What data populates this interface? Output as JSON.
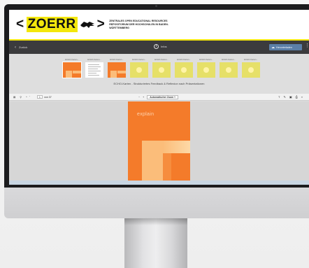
{
  "header": {
    "logo_left_bracket": "<",
    "logo_brand": "ZOERR",
    "logo_right_bracket": ">",
    "tagline": "ZENTRALES OPEN EDUCATIONAL RESOURCES REPOSITORIUM DER HOCHSCHULEN IN BADEN-WÜRTTEMBERG",
    "accent_color": "#f3e70c"
  },
  "toolbar": {
    "back_label": "Zurück",
    "info_label": "Infos",
    "download_label": "Herunterladen",
    "menu_icon": "kebab-icon"
  },
  "thumbnails": {
    "items": [
      {
        "label": "ECHO-Karten..."
      },
      {
        "label": "ECHO-Karten..."
      },
      {
        "label": "ECHO-Karten..."
      },
      {
        "label": "ECHO-Karten..."
      },
      {
        "label": "ECHO-Karten..."
      },
      {
        "label": "ECHO-Karten..."
      },
      {
        "label": "ECHO-Karten..."
      },
      {
        "label": "ECHO-Karten..."
      },
      {
        "label": "ECHO-Karten..."
      }
    ],
    "caption": "ECHO-Karten - Strukturiertes Feedback & Reflexion nach Präsentationen"
  },
  "pdf": {
    "page_number": "1",
    "page_total": "von 37",
    "zoom_label": "Automatischer Zoom",
    "zoom_minus": "−",
    "zoom_plus": "+",
    "page_word": "explain"
  }
}
